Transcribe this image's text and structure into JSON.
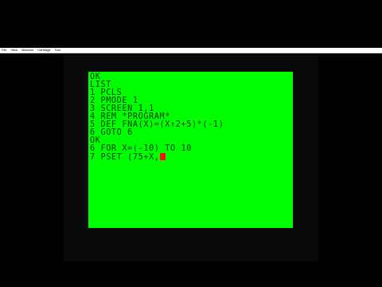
{
  "menubar": {
    "items": [
      "File",
      "View",
      "Machine",
      "Cartridge",
      "Tool"
    ]
  },
  "screen": {
    "lines": [
      "OK",
      "LIST",
      "1 PCLS",
      "2 PMODE 1",
      "3 SCREEN 1,1",
      "4 REM *PROGRAM*",
      "5 DEF FNA(X)=(X↑2+5)*(-1)",
      "6 GOTO 6",
      "OK",
      "6 FOR X=(-10) TO 10",
      "7 PSET (75+X,"
    ],
    "cursor_color": "#ff1010",
    "background_color": "#00ff00",
    "text_color": "#003300"
  }
}
